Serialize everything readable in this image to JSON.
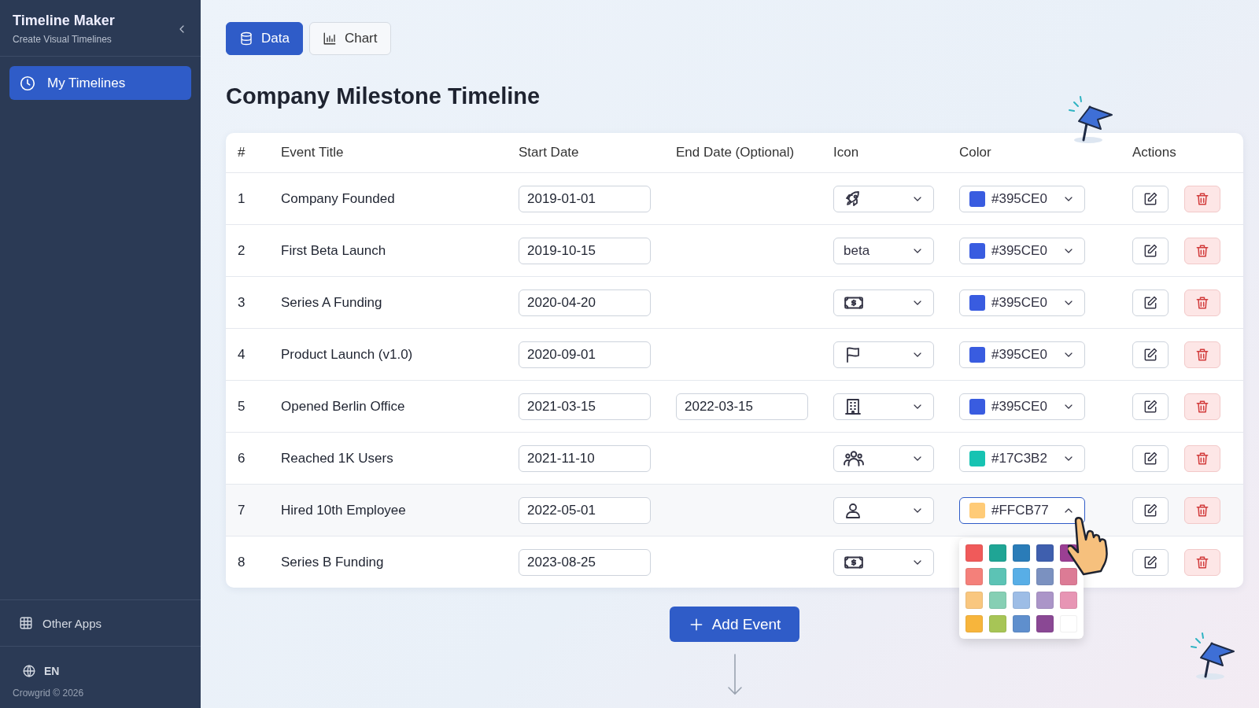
{
  "sidebar": {
    "title": "Timeline Maker",
    "subtitle": "Create Visual Timelines",
    "items": [
      {
        "label": "My Timelines",
        "selected": true
      }
    ],
    "other_apps": "Other Apps",
    "language": "EN",
    "footer": "Crowgrid © 2026"
  },
  "tabs": [
    {
      "label": "Data",
      "selected": true
    },
    {
      "label": "Chart",
      "selected": false
    }
  ],
  "title": "Company Milestone Timeline",
  "table": {
    "columns": [
      "#",
      "Event Title",
      "Start Date",
      "End Date (Optional)",
      "Icon",
      "Color",
      "Actions"
    ],
    "rows": [
      {
        "num": "1",
        "title": "Company Founded",
        "start": "2019-01-01",
        "icon": {
          "kind": "rocket"
        },
        "color": {
          "value": "#395CE0",
          "open": false
        }
      },
      {
        "num": "2",
        "title": "First Beta Launch",
        "start": "2019-10-15",
        "icon": {
          "kind": "text",
          "label": "beta"
        },
        "color": {
          "value": "#395CE0",
          "open": false
        }
      },
      {
        "num": "3",
        "title": "Series A Funding",
        "start": "2020-04-20",
        "icon": {
          "kind": "cash"
        },
        "color": {
          "value": "#395CE0",
          "open": false
        }
      },
      {
        "num": "4",
        "title": "Product Launch (v1.0)",
        "start": "2020-09-01",
        "icon": {
          "kind": "flag"
        },
        "color": {
          "value": "#395CE0",
          "open": false
        }
      },
      {
        "num": "5",
        "title": "Opened Berlin Office",
        "start": "2021-03-15",
        "end": "2022-03-15",
        "icon": {
          "kind": "building"
        },
        "color": {
          "value": "#395CE0",
          "open": false
        }
      },
      {
        "num": "6",
        "title": "Reached 1K Users",
        "start": "2021-11-10",
        "icon": {
          "kind": "users"
        },
        "color": {
          "value": "#17C3B2",
          "open": false
        }
      },
      {
        "num": "7",
        "title": "Hired 10th Employee",
        "start": "2022-05-01",
        "icon": {
          "kind": "user"
        },
        "color": {
          "value": "#FFCB77",
          "open": true
        }
      },
      {
        "num": "8",
        "title": "Series B Funding",
        "start": "2023-08-25",
        "icon": {
          "kind": "cash"
        }
      }
    ]
  },
  "palette": [
    {
      "color": "#f05a5a"
    },
    {
      "color": "#1fa595"
    },
    {
      "color": "#2a7cb8"
    },
    {
      "color": "#3f5fae"
    },
    {
      "color": "#9b3f93"
    },
    {
      "color": "#f4807a"
    },
    {
      "color": "#5cc3b5"
    },
    {
      "color": "#58aee6"
    },
    {
      "color": "#7b91c0"
    },
    {
      "color": "#dc7b95"
    },
    {
      "color": "#f9c77f"
    },
    {
      "color": "#86cfb4"
    },
    {
      "color": "#9dbde6"
    },
    {
      "color": "#ab95c8"
    },
    {
      "color": "#e795b4"
    },
    {
      "color": "#f7b53c"
    },
    {
      "color": "#a7c556"
    },
    {
      "color": "#5f8fcd"
    },
    {
      "color": "#8a4894"
    },
    {
      "color": "#ffffff"
    }
  ],
  "add_button": "Add Event"
}
